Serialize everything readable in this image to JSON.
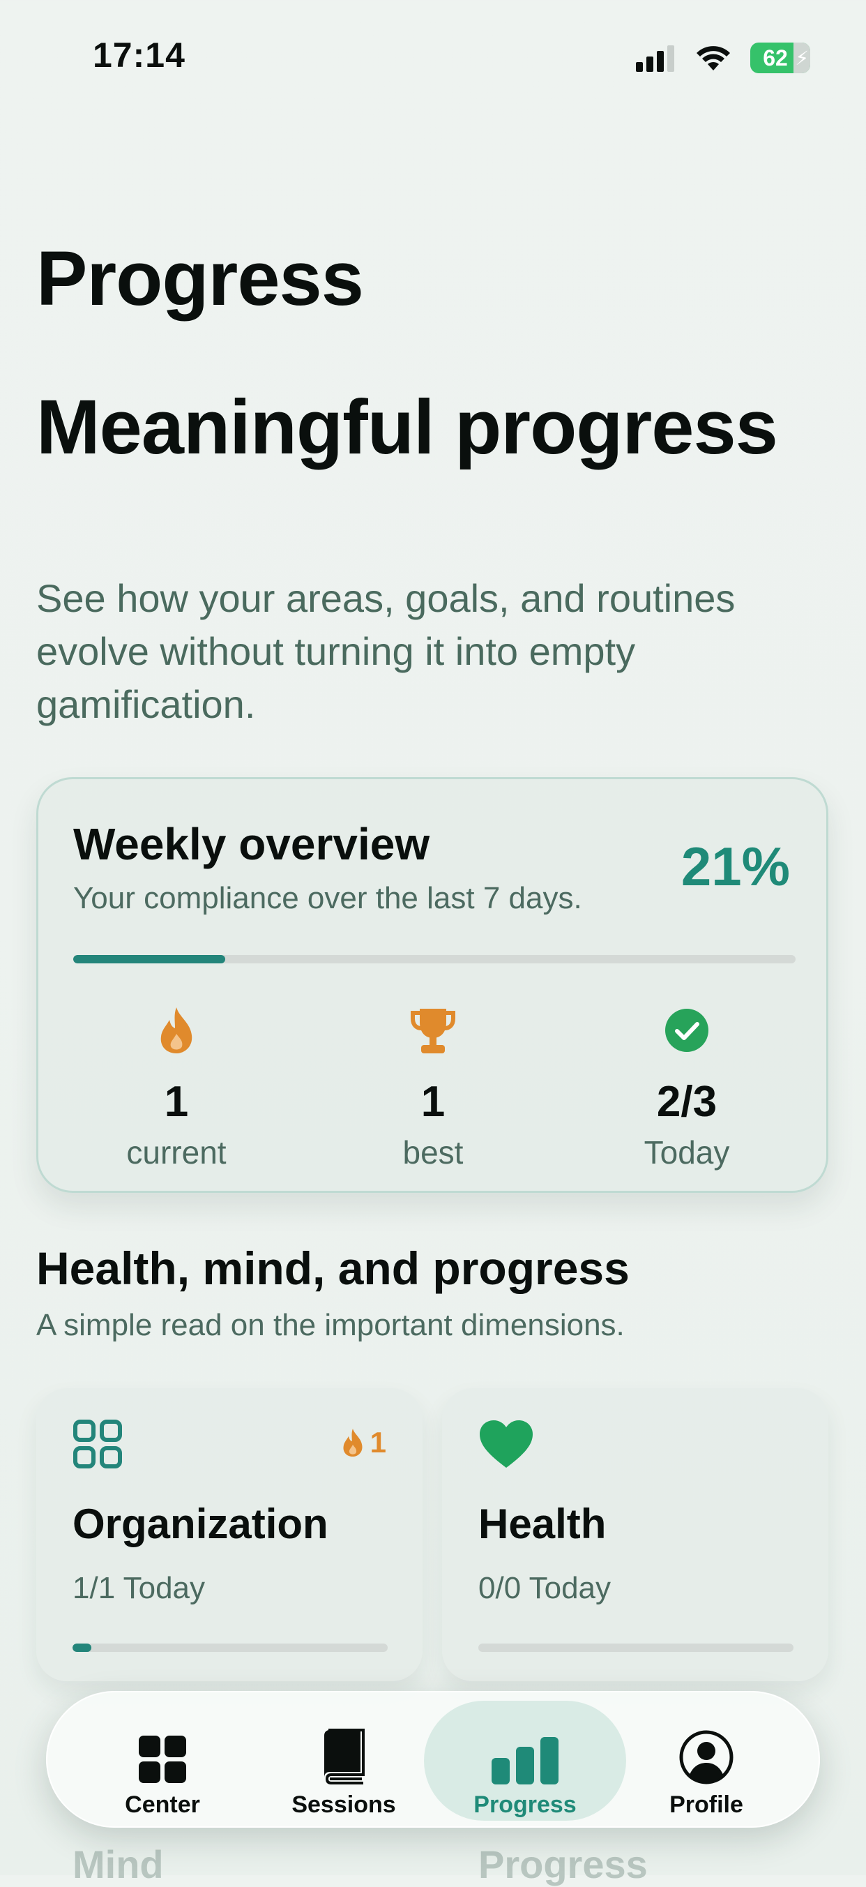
{
  "status_bar": {
    "time": "17:14",
    "battery": "62"
  },
  "page": {
    "title": "Progress",
    "hero_title": "Meaningful progress",
    "hero_subtitle": "See how your areas, goals, and routines evolve without turning it into empty gamification."
  },
  "weekly_overview": {
    "title": "Weekly overview",
    "subtitle": "Your compliance over the last 7 days.",
    "percent_label": "21%",
    "progress_fraction": 0.21,
    "stats": [
      {
        "icon": "flame-icon",
        "value": "1",
        "label": "current"
      },
      {
        "icon": "trophy-icon",
        "value": "1",
        "label": "best"
      },
      {
        "icon": "check-circle-icon",
        "value": "2/3",
        "label": "Today"
      }
    ]
  },
  "dimensions_section": {
    "title": "Health, mind, and progress",
    "subtitle": "A simple read on the important dimensions.",
    "cards": [
      {
        "name": "Organization",
        "today": "1/1 Today",
        "icon": "grid-icon",
        "streak": "1",
        "progress_fraction": 0.06
      },
      {
        "name": "Health",
        "today": "0/0 Today",
        "icon": "heart-icon",
        "progress_fraction": 0
      }
    ],
    "peek_cards": [
      "Mind",
      "Progress"
    ]
  },
  "tab_bar": {
    "tabs": [
      {
        "label": "Center",
        "icon": "grid-icon"
      },
      {
        "label": "Sessions",
        "icon": "book-icon"
      },
      {
        "label": "Progress",
        "icon": "bar-chart-icon",
        "active": true
      },
      {
        "label": "Profile",
        "icon": "person-circle-icon"
      }
    ]
  },
  "colors": {
    "accent": "#1f8a78",
    "flame": "#e08a2c",
    "heart": "#1fa35c",
    "check": "#27a35a"
  }
}
